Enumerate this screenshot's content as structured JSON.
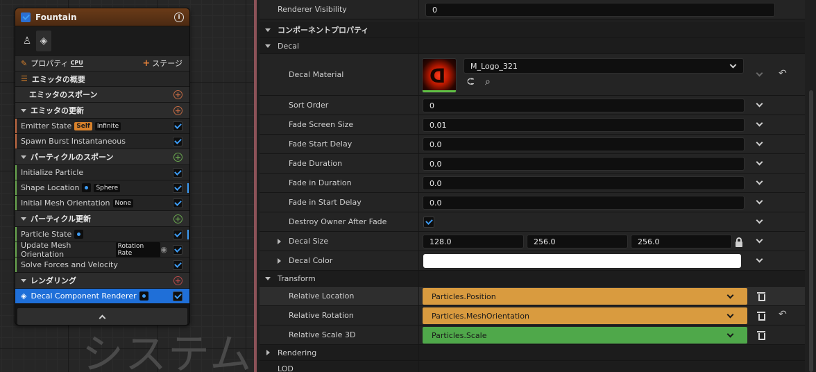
{
  "emitter": {
    "title": "Fountain",
    "properties_label": "プロパティ",
    "cpu_label": "CPU",
    "stage_label": "ステージ",
    "overview_label": "エミッタの概要",
    "sections": [
      {
        "label": "エミッタのスポーン",
        "modules": []
      },
      {
        "label": "エミッタの更新",
        "modules": [
          {
            "label": "Emitter State",
            "tags": [
              "Self",
              "Infinite"
            ]
          },
          {
            "label": "Spawn Burst Instantaneous",
            "tags": []
          }
        ]
      },
      {
        "label": "パーティクルのスポーン",
        "modules": [
          {
            "label": "Initialize Particle",
            "tags": []
          },
          {
            "label": "Shape Location",
            "tags": [
              "Sphere"
            ]
          },
          {
            "label": "Initial Mesh Orientation",
            "tags": [
              "None"
            ]
          }
        ]
      },
      {
        "label": "パーティクル更新",
        "modules": [
          {
            "label": "Particle State",
            "tags": []
          },
          {
            "label": "Update Mesh Orientation",
            "tags": [
              "Rotation Rate"
            ]
          },
          {
            "label": "Solve Forces and Velocity",
            "tags": []
          }
        ]
      },
      {
        "label": "レンダリング",
        "modules": [
          {
            "label": "Decal Component Renderer",
            "tags": []
          }
        ]
      }
    ],
    "watermark": "システム"
  },
  "details": {
    "renderer_visibility": {
      "label": "Renderer Visibility",
      "value": "0"
    },
    "component_props_label": "コンポーネントプロパティ",
    "decal_category": "Decal",
    "decal_material": {
      "label": "Decal Material",
      "value": "M_Logo_321"
    },
    "sort_order": {
      "label": "Sort Order",
      "value": "0"
    },
    "fade_screen_size": {
      "label": "Fade Screen Size",
      "value": "0.01"
    },
    "fade_start_delay": {
      "label": "Fade Start Delay",
      "value": "0.0"
    },
    "fade_duration": {
      "label": "Fade Duration",
      "value": "0.0"
    },
    "fade_in_duration": {
      "label": "Fade in Duration",
      "value": "0.0"
    },
    "fade_in_start_delay": {
      "label": "Fade in Start Delay",
      "value": "0.0"
    },
    "destroy_owner": {
      "label": "Destroy Owner After Fade",
      "checked": true
    },
    "decal_size": {
      "label": "Decal Size",
      "x": "128.0",
      "y": "256.0",
      "z": "256.0"
    },
    "decal_color": {
      "label": "Decal Color",
      "color": "#ffffff"
    },
    "transform_category": "Transform",
    "relative_location": {
      "label": "Relative Location",
      "value": "Particles.Position"
    },
    "relative_rotation": {
      "label": "Relative Rotation",
      "value": "Particles.MeshOrientation"
    },
    "relative_scale": {
      "label": "Relative Scale 3D",
      "value": "Particles.Scale"
    },
    "rendering_category": "Rendering",
    "lod_category": "LOD"
  },
  "colors": {
    "header_brown": "#6a3b18",
    "binding_orange": "#d99b3f",
    "binding_green": "#4fa84a",
    "selected_blue": "#1f6fd8",
    "accent_blue": "#3d9cf5",
    "panel_border": "#8c5258"
  }
}
